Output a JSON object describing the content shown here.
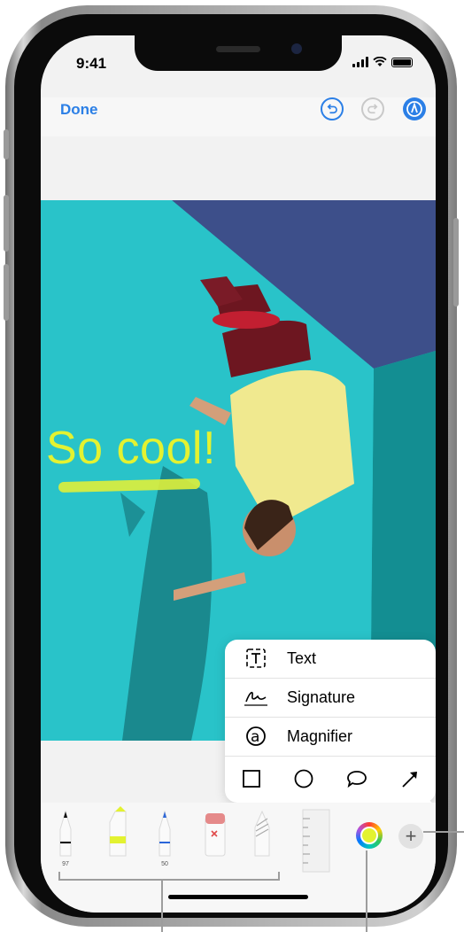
{
  "status_bar": {
    "time": "9:41"
  },
  "nav": {
    "done_label": "Done"
  },
  "photo": {
    "sticker_text": "So cool!"
  },
  "markup_menu": {
    "items": [
      {
        "label": "Text",
        "icon": "text-box-icon"
      },
      {
        "label": "Signature",
        "icon": "signature-icon"
      },
      {
        "label": "Magnifier",
        "icon": "magnifier-icon"
      }
    ],
    "shapes": [
      "square-icon",
      "circle-icon",
      "speech-bubble-icon",
      "arrow-icon"
    ]
  },
  "tools": {
    "pen_width": "97",
    "marker_width": "50",
    "add_label": "+"
  },
  "colors": {
    "accent": "#2b7fe6",
    "highlighter": "#e3f231",
    "pen_blue": "#2b66d9",
    "eraser": "#e58a8a"
  }
}
